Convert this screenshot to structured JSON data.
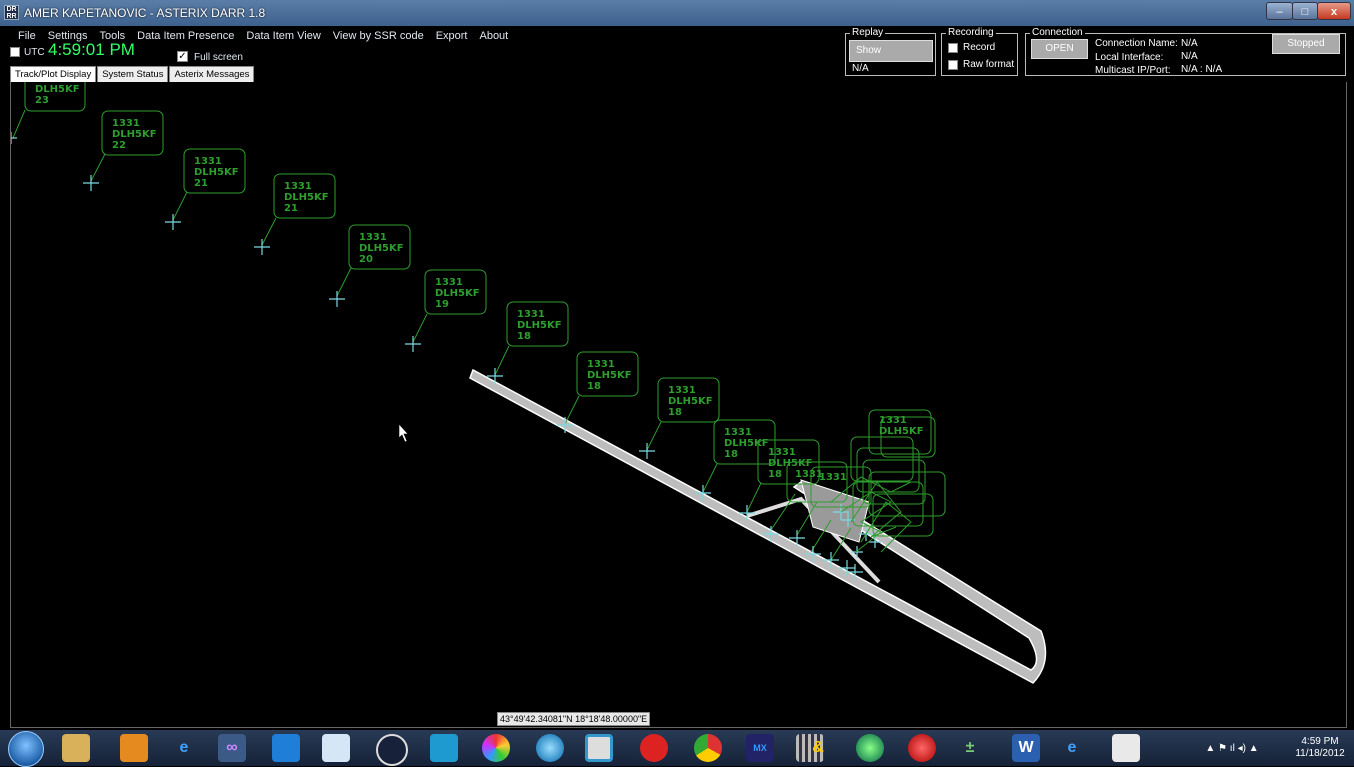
{
  "window": {
    "app_icon": "DR RR",
    "title": "AMER KAPETANOVIC - ASTERIX DARR  1.8",
    "min": "–",
    "max": "□",
    "close": "x"
  },
  "menu": [
    "File",
    "Settings",
    "Tools",
    "Data Item Presence",
    "Data Item View",
    "View by SSR code",
    "Export",
    "About"
  ],
  "utc_label": "UTC",
  "clock": "4:59:01 PM",
  "fullscreen_label": "Full screen",
  "fullscreen_check": "✓",
  "tabs": [
    "Track/Plot Display",
    "System Status",
    "Asterix Messages"
  ],
  "replay": {
    "legend": "Replay",
    "show_button": "Show",
    "status": "N/A"
  },
  "recording": {
    "legend": "Recording",
    "record": "Record",
    "raw": "Raw format"
  },
  "connection": {
    "legend": "Connection",
    "open_button": "OPEN",
    "name_label": "Connection Name:",
    "name_value": "N/A",
    "iface_label": "Local Interface:",
    "iface_value": "N/A",
    "mcast_label": "Multicast IP/Port:",
    "mcast_value": "N/A : N/A"
  },
  "stopped_button": "Stopped",
  "tracks": [
    {
      "ssr": "",
      "callsign": "DLH5KF",
      "fl": "23"
    },
    {
      "ssr": "1331",
      "callsign": "DLH5KF",
      "fl": "22"
    },
    {
      "ssr": "1331",
      "callsign": "DLH5KF",
      "fl": "21"
    },
    {
      "ssr": "1331",
      "callsign": "DLH5KF",
      "fl": "21"
    },
    {
      "ssr": "1331",
      "callsign": "DLH5KF",
      "fl": "20"
    },
    {
      "ssr": "1331",
      "callsign": "DLH5KF",
      "fl": "19"
    },
    {
      "ssr": "1331",
      "callsign": "DLH5KF",
      "fl": "18"
    },
    {
      "ssr": "1331",
      "callsign": "DLH5KF",
      "fl": "18"
    },
    {
      "ssr": "1331",
      "callsign": "DLH5KF",
      "fl": "18"
    },
    {
      "ssr": "1331",
      "callsign": "DLH5KF",
      "fl": "18"
    },
    {
      "ssr": "1331",
      "callsign": "DLH5KF",
      "fl": "18"
    },
    {
      "ssr": "1331",
      "callsign": "",
      "fl": ""
    },
    {
      "ssr": "1331",
      "callsign": "",
      "fl": ""
    },
    {
      "ssr": "1331",
      "callsign": "DLH5KF",
      "fl": ""
    }
  ],
  "colors": {
    "track_label": "#2e9e2e",
    "plot_cross": "#7ad9e0",
    "runway": "#d8d8d8",
    "clock": "#33ff66"
  },
  "coordinate_readout": "43°49'42.34081\"N 18°18'48.00000\"E",
  "taskbar_icons": [
    "windows-start",
    "explorer-folder",
    "media-player",
    "internet-explorer",
    "chain-app",
    "outlook",
    "hand-app",
    "google-earth",
    "wave-app",
    "picasa",
    "globe",
    "app-square",
    "ccleaner",
    "chrome",
    "mx-app",
    "grid-app",
    "link-app",
    "globe-green",
    "red-app",
    "calc-app",
    "word",
    "internet-explorer-2",
    "notepad"
  ],
  "tray": {
    "time": "4:59 PM",
    "date": "11/18/2012"
  }
}
